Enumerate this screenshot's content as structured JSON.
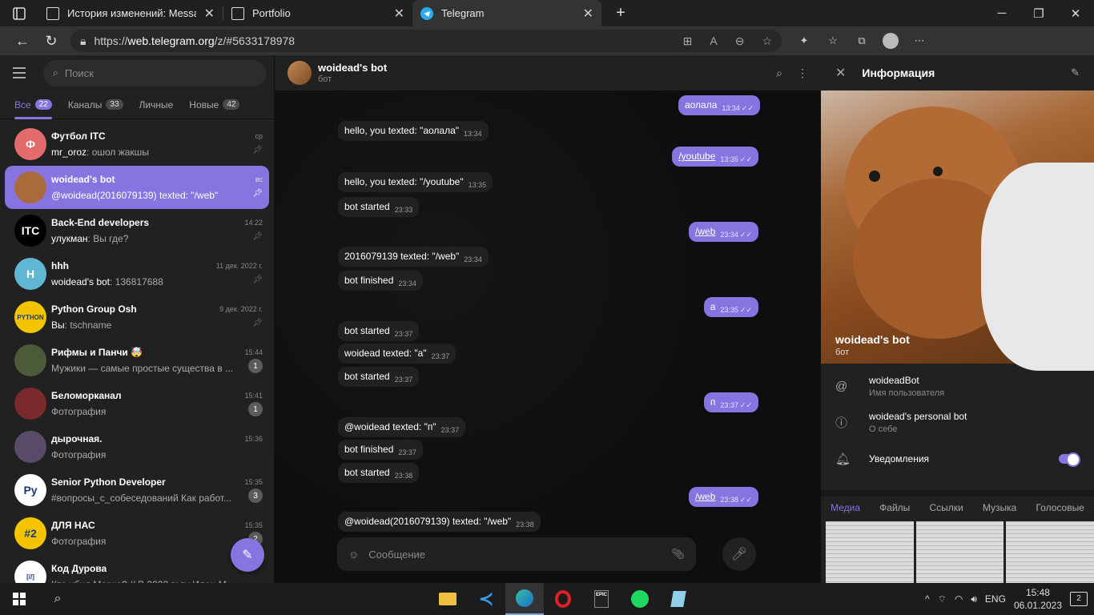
{
  "browser": {
    "tabs": [
      {
        "title": "История изменений: Message o",
        "active": false
      },
      {
        "title": "Portfolio",
        "active": false
      },
      {
        "title": "Telegram",
        "active": true
      }
    ],
    "url_prefix": "https://",
    "url_host": "web.telegram.org",
    "url_path": "/z/#5633178978"
  },
  "sidebar": {
    "search_placeholder": "Поиск",
    "folders": [
      {
        "label": "Все",
        "count": "22"
      },
      {
        "label": "Каналы",
        "count": "33"
      },
      {
        "label": "Личные",
        "count": ""
      },
      {
        "label": "Новые",
        "count": "42"
      }
    ],
    "chats": [
      {
        "name": "Футбол ITC",
        "time": "ср",
        "sender": "mr_oroz",
        "text": "ошол жакшы",
        "avatar_text": "Ф",
        "avatar_color": "#e36b6b"
      },
      {
        "name": "woidead's bot",
        "time": "вс",
        "sender": "",
        "text": "@woidead(2016079139) texted: \"/web\"",
        "avatar_text": "",
        "avatar_color": "#a96b3a"
      },
      {
        "name": "Back-End developers",
        "time": "14:22",
        "sender": "улукман",
        "text": "Вы где?",
        "avatar_text": "ITC",
        "avatar_color": "#000000"
      },
      {
        "name": "hhh",
        "time": "11 дек. 2022 г.",
        "sender": "woidead's bot",
        "text": "136817688",
        "avatar_text": "H",
        "avatar_color": "#5fb7d4"
      },
      {
        "name": "Python Group Osh",
        "time": "9 дек. 2022 г.",
        "sender": "Вы",
        "text": "tschname",
        "avatar_text": "PYTHON",
        "avatar_color": "#f2c400"
      },
      {
        "name": "Рифмы и Панчи 🤯",
        "time": "15:44",
        "sender": "",
        "text": "Мужики — самые простые существа в ...",
        "avatar_text": "",
        "avatar_color": "#4c5a3a",
        "unread": "1"
      },
      {
        "name": "Беломорканал",
        "time": "15:41",
        "sender": "",
        "text": "Фотография",
        "avatar_text": "",
        "avatar_color": "#7a2a2a",
        "unread": "1"
      },
      {
        "name": "дырочная.",
        "time": "15:36",
        "sender": "",
        "text": "Фотография",
        "avatar_text": "",
        "avatar_color": "#5a4a6a"
      },
      {
        "name": "Senior Python Developer",
        "time": "15:35",
        "sender": "",
        "text": "#вопросы_с_собеседований Как работ...",
        "avatar_text": "Py",
        "avatar_color": "#ffffff",
        "unread": "3"
      },
      {
        "name": "ДЛЯ НАС",
        "time": "15:35",
        "sender": "",
        "text": "Фотография",
        "avatar_text": "#2",
        "avatar_color": "#f5c400",
        "unread": "2"
      },
      {
        "name": "Код Дурова",
        "time": "",
        "sender": "",
        "text": "Кто убил Марка? // В 2022 году Илон М...",
        "avatar_text": "[//]",
        "avatar_color": "#ffffff"
      }
    ]
  },
  "chat": {
    "title": "woidead's bot",
    "subtitle": "бот",
    "messages": [
      {
        "dir": "out",
        "text": "аолала",
        "time": "13:34"
      },
      {
        "dir": "in",
        "text": "hello, you texted: \"аолала\"",
        "time": "13:34"
      },
      {
        "dir": "out",
        "text": "/youtube",
        "time": "13:35"
      },
      {
        "dir": "in",
        "text": "hello, you texted: \"/youtube\"",
        "time": "13:35"
      },
      {
        "dir": "in",
        "text": "bot started",
        "time": "23:33"
      },
      {
        "dir": "out",
        "text": "/web",
        "time": "23:34"
      },
      {
        "dir": "in",
        "text": "2016079139 texted: \"/web\"",
        "time": "23:34"
      },
      {
        "dir": "in",
        "text": "bot finished",
        "time": "23:34"
      },
      {
        "dir": "out",
        "text": "а",
        "time": "23:35"
      },
      {
        "dir": "in",
        "text": "bot started",
        "time": "23:37"
      },
      {
        "dir": "in",
        "text": "woidead texted: \"а\"",
        "time": "23:37"
      },
      {
        "dir": "in",
        "text": "bot started",
        "time": "23:37"
      },
      {
        "dir": "out",
        "text": "п",
        "time": "23:37"
      },
      {
        "dir": "in",
        "text": "@woidead texted: \"п\"",
        "time": "23:37"
      },
      {
        "dir": "in",
        "text": "bot finished",
        "time": "23:37"
      },
      {
        "dir": "in",
        "text": "bot started",
        "time": "23:38"
      },
      {
        "dir": "out",
        "text": "/web",
        "time": "23:38"
      },
      {
        "dir": "in",
        "text": "@woidead(2016079139) texted: \"/web\"",
        "time": "23:38"
      }
    ],
    "composer_placeholder": "Сообщение"
  },
  "info": {
    "title": "Информация",
    "name": "woidead's bot",
    "subtitle": "бот",
    "username": "woideadBot",
    "username_label": "Имя пользователя",
    "about": "woidead's personal bot",
    "about_label": "О себе",
    "notifications_label": "Уведомления",
    "notifications_on": true,
    "media_tabs": [
      "Медиа",
      "Файлы",
      "Ссылки",
      "Музыка",
      "Голосовые"
    ]
  },
  "taskbar": {
    "lang": "ENG",
    "time": "15:48",
    "date": "06.01.2023",
    "notifications": "2"
  }
}
